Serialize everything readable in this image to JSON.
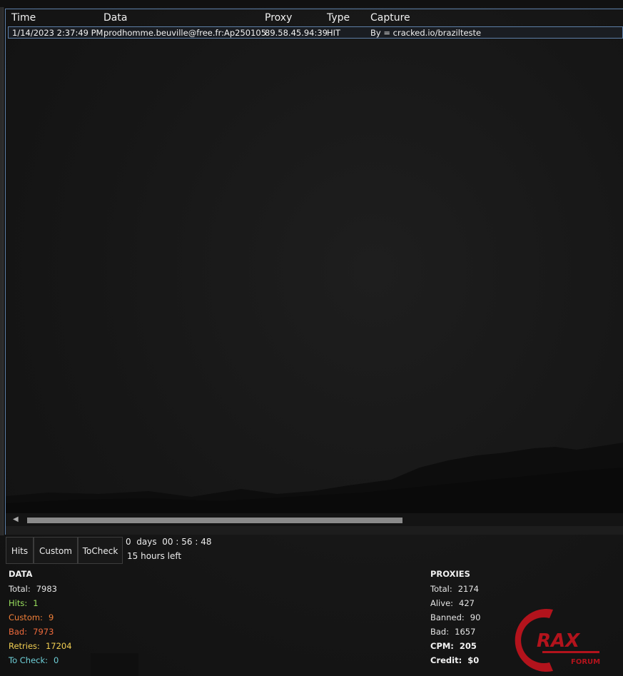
{
  "list": {
    "columns": [
      "Time",
      "Data",
      "Proxy",
      "Type",
      "Capture"
    ],
    "rows": [
      {
        "time": "1/14/2023 2:37:49 PM",
        "data": "prodhomme.beuville@free.fr:Ap250105",
        "proxy": "89.58.45.94:39",
        "type": "HIT",
        "capture": "By = cracked.io/brazilteste"
      }
    ]
  },
  "tabs": [
    "Hits",
    "Custom",
    "ToCheck"
  ],
  "timer": {
    "days": "0",
    "days_label": "days",
    "hh": "00",
    "mm": "56",
    "ss": "48",
    "sep": ":",
    "left": "15 hours left"
  },
  "data_stats": {
    "title": "DATA",
    "items": [
      {
        "label": "Total:",
        "value": "7983",
        "color": "#e6e6e6"
      },
      {
        "label": "Hits:",
        "value": "1",
        "color": "#9be25f"
      },
      {
        "label": "Custom:",
        "value": "9",
        "color": "#f07f38"
      },
      {
        "label": "Bad:",
        "value": "7973",
        "color": "#ef6a3c"
      },
      {
        "label": "Retries:",
        "value": "17204",
        "color": "#f2cf52"
      },
      {
        "label": "To Check:",
        "value": "0",
        "color": "#6fd0d8"
      }
    ]
  },
  "proxy_stats": {
    "title": "PROXIES",
    "items": [
      {
        "label": "Total:",
        "value": "2174"
      },
      {
        "label": "Alive:",
        "value": "427"
      },
      {
        "label": "Banned:",
        "value": "90"
      },
      {
        "label": "Bad:",
        "value": "1657"
      },
      {
        "label": "CPM:",
        "value": "205"
      },
      {
        "label": "Credit:",
        "value": "$0"
      }
    ]
  },
  "logo": {
    "text": "RAX",
    "sub": "FORUM",
    "color": "#b3131c"
  }
}
